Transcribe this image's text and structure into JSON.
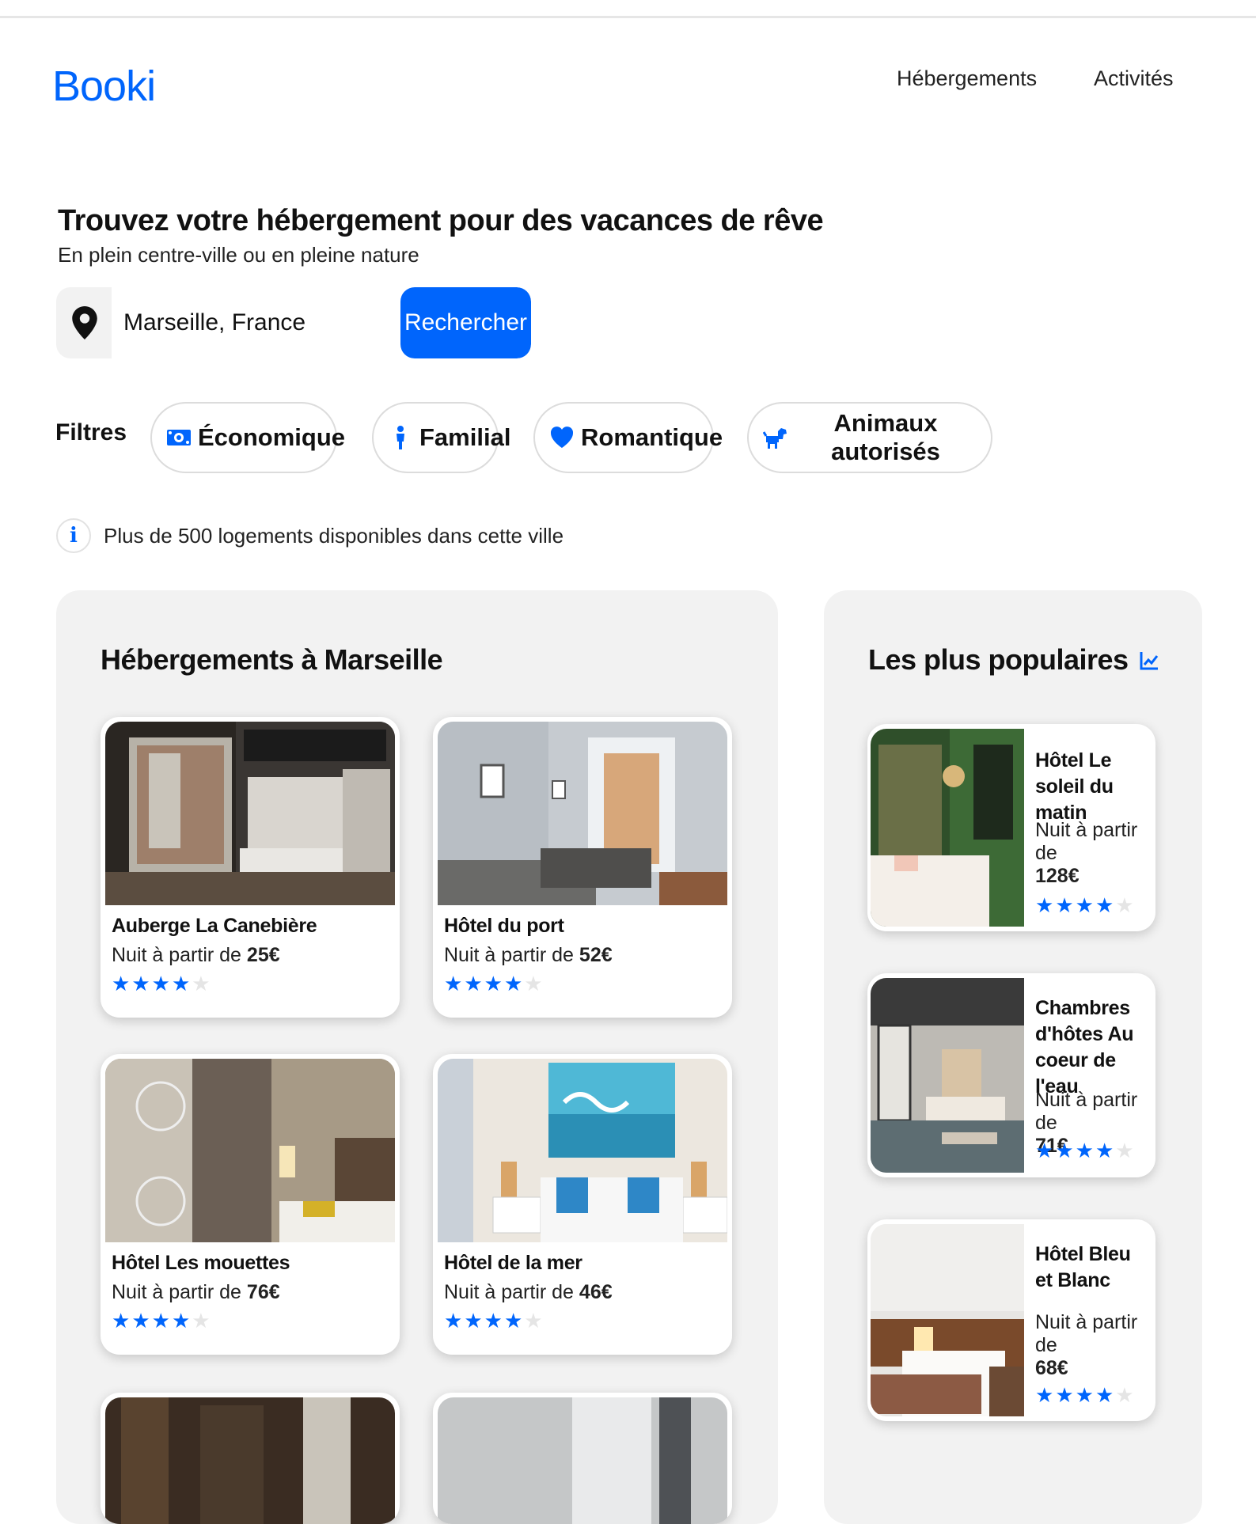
{
  "header": {
    "logo": "Booki",
    "nav": [
      "Hébergements",
      "Activités"
    ]
  },
  "hero": {
    "title": "Trouvez votre hébergement pour des vacances de rêve",
    "subtitle": "En plein centre-ville ou en pleine nature"
  },
  "search": {
    "value": "Marseille, France",
    "button": "Rechercher"
  },
  "filters": {
    "label": "Filtres",
    "items": [
      "Économique",
      "Familial",
      "Romantique",
      "Animaux autorisés"
    ]
  },
  "info": {
    "text": "Plus de 500 logements disponibles dans cette ville"
  },
  "listings": {
    "title": "Hébergements à Marseille",
    "price_prefix": "Nuit à partir de ",
    "items": [
      {
        "name": "Auberge La Canebière",
        "price": "25€",
        "rating": 4
      },
      {
        "name": "Hôtel du port",
        "price": "52€",
        "rating": 4
      },
      {
        "name": "Hôtel Les mouettes",
        "price": "76€",
        "rating": 4
      },
      {
        "name": "Hôtel de la mer",
        "price": "46€",
        "rating": 4
      }
    ]
  },
  "popular": {
    "title": "Les plus populaires",
    "price_prefix": "Nuit à partir de",
    "items": [
      {
        "name": "Hôtel Le soleil du matin",
        "price": "128€",
        "rating": 4
      },
      {
        "name": "Chambres d'hôtes Au coeur de l'eau",
        "price": "71€",
        "rating": 4
      },
      {
        "name": "Hôtel Bleu et Blanc",
        "price": "68€",
        "rating": 4
      }
    ]
  },
  "colors": {
    "accent": "#0065fc",
    "panel": "#f2f2f2"
  },
  "icons": [
    "location-pin-icon",
    "money-icon",
    "child-icon",
    "heart-icon",
    "dog-icon",
    "info-icon",
    "chart-line-icon",
    "star-icon"
  ]
}
